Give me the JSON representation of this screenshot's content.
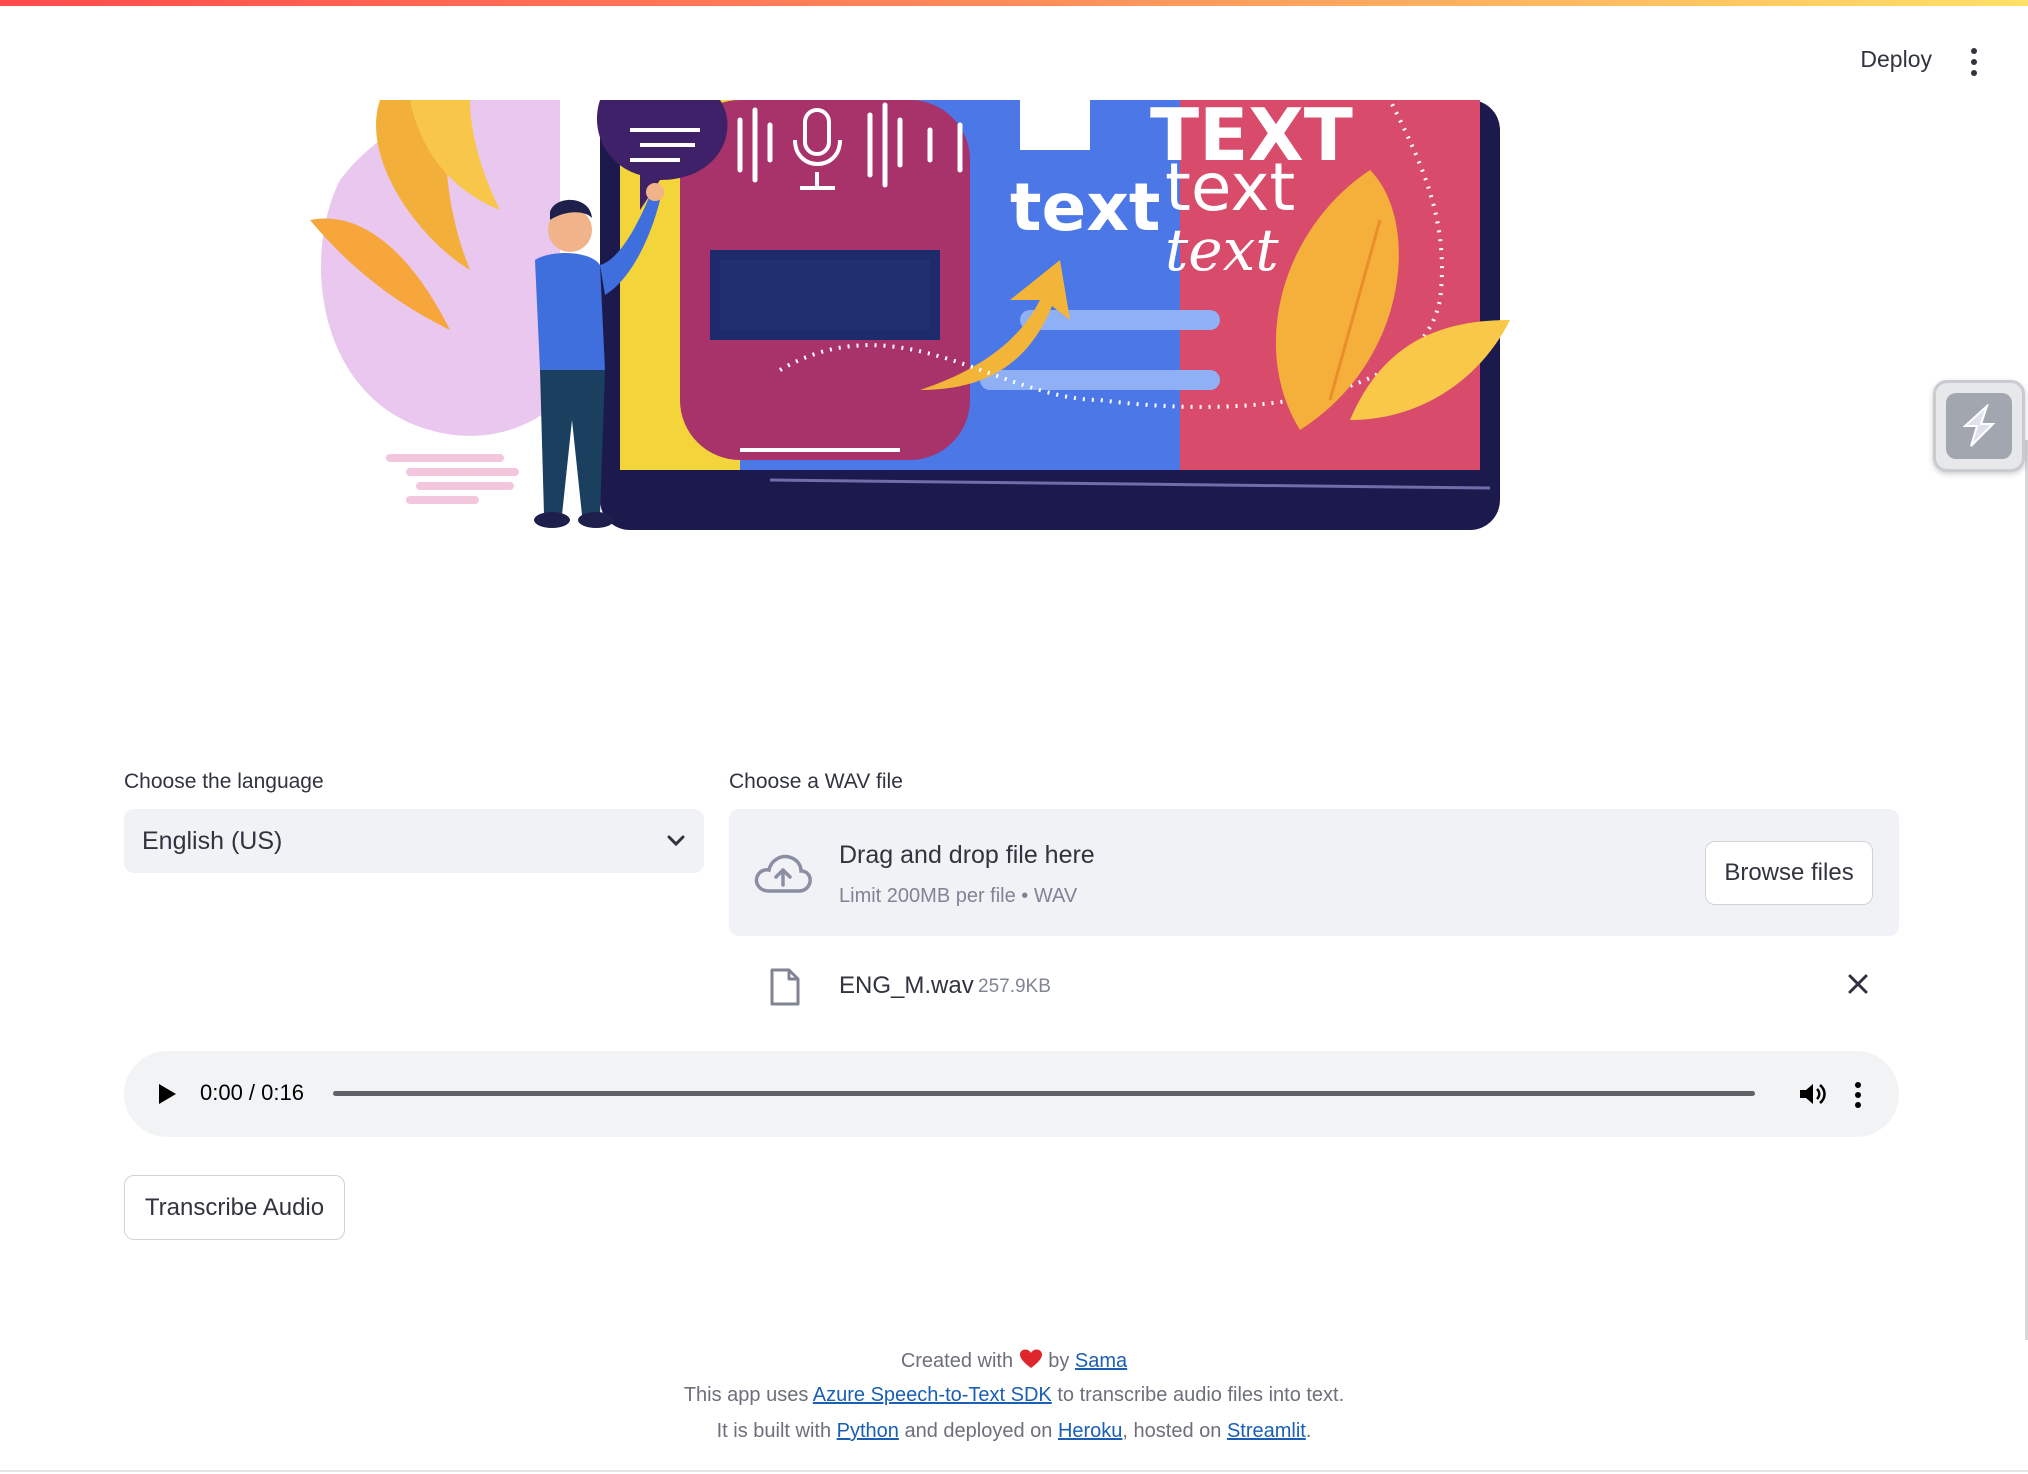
{
  "header": {
    "deploy_label": "Deploy",
    "menu_icon": "kebab-icon"
  },
  "hero": {
    "caption_big": "TEXT",
    "caption_1": "text",
    "caption_2": "text",
    "caption_3": "text"
  },
  "language": {
    "label": "Choose the language",
    "selected": "English (US)"
  },
  "upload": {
    "label": "Choose a WAV file",
    "drop_title": "Drag and drop file here",
    "drop_subtitle": "Limit 200MB per file • WAV",
    "browse_label": "Browse files",
    "file": {
      "name": "ENG_M.wav",
      "size": "257.9KB"
    }
  },
  "audio": {
    "time": "0:00 / 0:16",
    "progress": 0
  },
  "actions": {
    "transcribe_label": "Transcribe Audio"
  },
  "footer": {
    "line1_prefix": "Created with",
    "line1_by": "by",
    "line1_link": "Sama",
    "line2_prefix": "This app uses",
    "line2_link": "Azure Speech-to-Text SDK",
    "line2_suffix": "to transcribe audio files into text.",
    "line3_prefix": "It is built with",
    "line3_link1": "Python",
    "line3_mid1": "and deployed on",
    "line3_link2": "Heroku",
    "line3_mid2": ", hosted on",
    "line3_link3": "Streamlit",
    "line3_end": "."
  },
  "colors": {
    "accent_gradient": [
      "#ff4b4b",
      "#ffe066"
    ],
    "link": "#1a5fb4",
    "widget_bg": "#f0f2f6"
  }
}
